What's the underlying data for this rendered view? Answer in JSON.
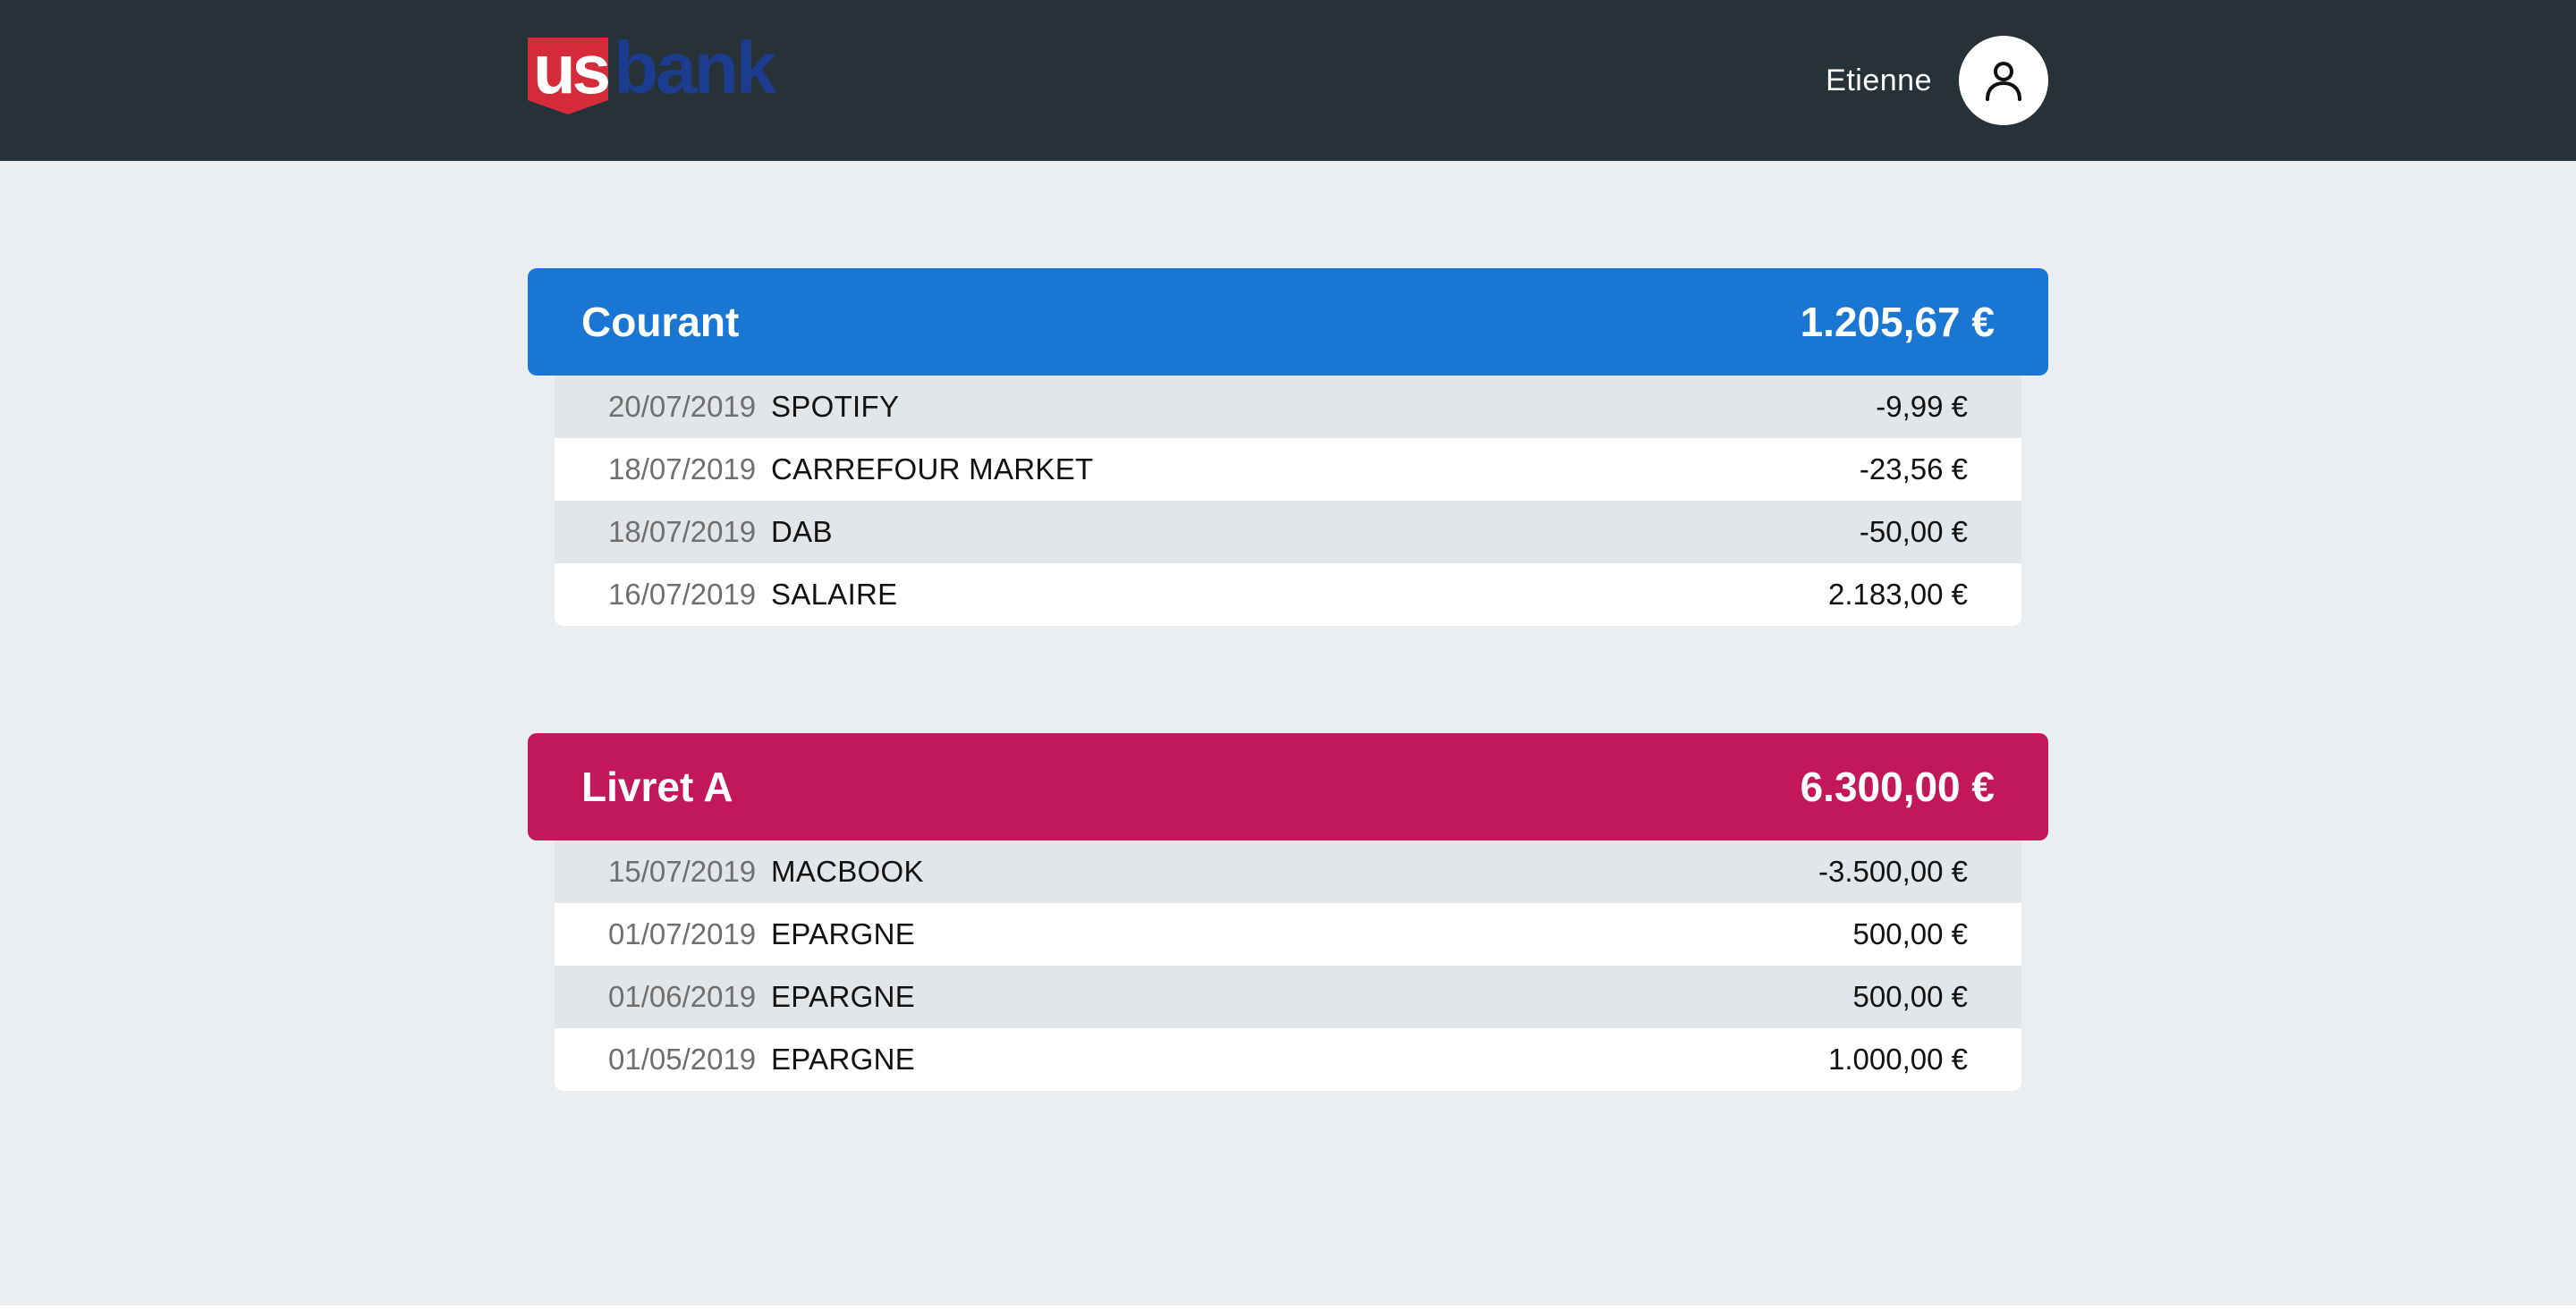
{
  "header": {
    "logo_us": "us",
    "logo_bank": "bank",
    "user_name": "Etienne",
    "avatar_icon": "user-icon",
    "colors": {
      "background": "#263238",
      "logo_red": "#d52b3a",
      "logo_blue": "#1b3c8f"
    }
  },
  "accounts": [
    {
      "name": "Courant",
      "balance": "1.205,67 €",
      "color": "#1976d2",
      "transactions": [
        {
          "date": "20/07/2019",
          "label": "SPOTIFY",
          "amount": "-9,99 €"
        },
        {
          "date": "18/07/2019",
          "label": "CARREFOUR MARKET",
          "amount": "-23,56 €"
        },
        {
          "date": "18/07/2019",
          "label": "DAB",
          "amount": "-50,00 €"
        },
        {
          "date": "16/07/2019",
          "label": "SALAIRE",
          "amount": "2.183,00 €"
        }
      ]
    },
    {
      "name": "Livret A",
      "balance": "6.300,00 €",
      "color": "#c2185b",
      "transactions": [
        {
          "date": "15/07/2019",
          "label": "MACBOOK",
          "amount": "-3.500,00 €"
        },
        {
          "date": "01/07/2019",
          "label": "EPARGNE",
          "amount": "500,00 €"
        },
        {
          "date": "01/06/2019",
          "label": "EPARGNE",
          "amount": "500,00 €"
        },
        {
          "date": "01/05/2019",
          "label": "EPARGNE",
          "amount": "1.000,00 €"
        }
      ]
    }
  ]
}
